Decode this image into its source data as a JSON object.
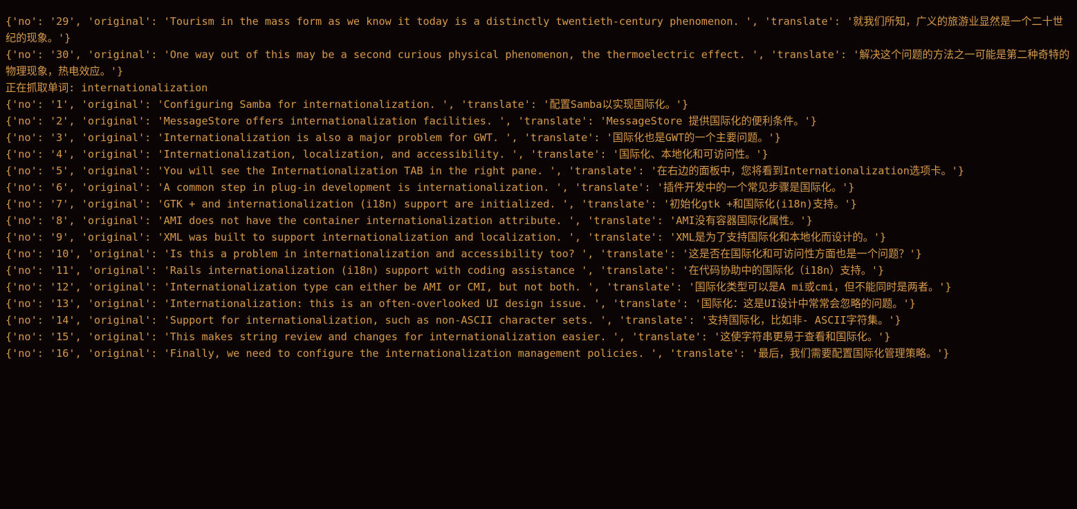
{
  "terminal": {
    "prev_entries": [
      {
        "no": "29",
        "original": "Tourism in the mass form as we know it today is a distinctly twentieth-century phenomenon. ",
        "translate": "就我们所知，广义的旅游业显然是一个二十世纪的现象。"
      },
      {
        "no": "30",
        "original": "One way out of this may be a second curious physical phenomenon, the thermoelectric effect. ",
        "translate": "解决这个问题的方法之一可能是第二种奇特的物理现象，热电效应。"
      }
    ],
    "status_line": "正在抓取单词: internationalization",
    "entries": [
      {
        "no": "1",
        "original": "Configuring Samba for internationalization. ",
        "translate": "配置Samba以实现国际化。"
      },
      {
        "no": "2",
        "original": "MessageStore offers internationalization facilities. ",
        "translate": "MessageStore 提供国际化的便利条件。"
      },
      {
        "no": "3",
        "original": "Internationalization is also a major problem for GWT. ",
        "translate": "国际化也是GWT的一个主要问题。"
      },
      {
        "no": "4",
        "original": "Internationalization, localization, and accessibility. ",
        "translate": "国际化、本地化和可访问性。"
      },
      {
        "no": "5",
        "original": "You will see the Internationalization TAB in the right pane. ",
        "translate": "在右边的面板中，您将看到Internationalization选项卡。"
      },
      {
        "no": "6",
        "original": "A common step in plug-in development is internationalization. ",
        "translate": "插件开发中的一个常见步骤是国际化。"
      },
      {
        "no": "7",
        "original": "GTK + and internationalization (i18n) support are initialized. ",
        "translate": "初始化gtk +和国际化(i18n)支持。"
      },
      {
        "no": "8",
        "original": "AMI does not have the container internationalization attribute. ",
        "translate": "AMI没有容器国际化属性。"
      },
      {
        "no": "9",
        "original": "XML was built to support internationalization and localization. ",
        "translate": "XML是为了支持国际化和本地化而设计的。"
      },
      {
        "no": "10",
        "original": "Is this a problem in internationalization and accessibility too? ",
        "translate": "这是否在国际化和可访问性方面也是一个问题？"
      },
      {
        "no": "11",
        "original": "Rails internationalization (i18n) support with coding assistance ",
        "translate": "在代码协助中的国际化（i18n）支持。"
      },
      {
        "no": "12",
        "original": "Internationalization type can either be AMI or CMI, but not both. ",
        "translate": "国际化类型可以是A mi或cmi，但不能同时是两者。"
      },
      {
        "no": "13",
        "original": "Internationalization: this is an often-overlooked UI design issue. ",
        "translate": "国际化：这是UI设计中常常会忽略的问题。"
      },
      {
        "no": "14",
        "original": "Support for internationalization, such as non-ASCII character sets. ",
        "translate": "支持国际化，比如非- ASCII字符集。"
      },
      {
        "no": "15",
        "original": "This makes string review and changes for internationalization easier. ",
        "translate": "这使字符串更易于查看和国际化。"
      },
      {
        "no": "16",
        "original": "Finally, we need to configure the internationalization management policies. ",
        "translate": "最后，我们需要配置国际化管理策略。"
      }
    ]
  }
}
